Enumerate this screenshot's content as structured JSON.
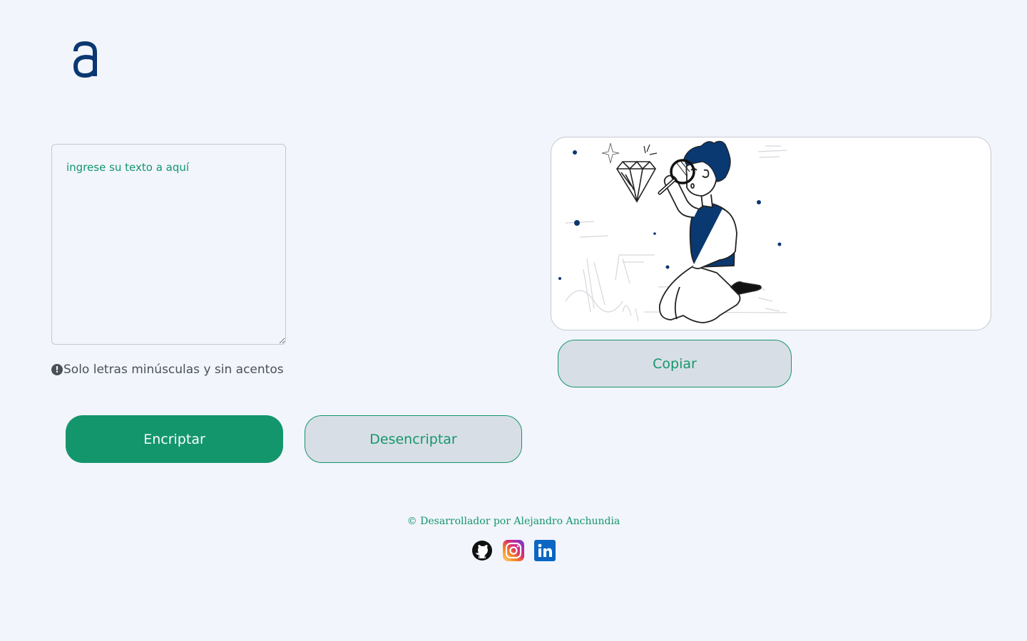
{
  "app": {
    "logo_letter": "a",
    "brand_color": "#0a3871",
    "accent_color": "#14966c",
    "background_color": "#f2f5fc"
  },
  "input": {
    "placeholder": "ingrese su texto a aquí",
    "value": ""
  },
  "hint": {
    "icon": "exclamation-circle-icon",
    "text": "Solo letras minúsculas y sin acentos"
  },
  "buttons": {
    "encrypt_label": "Encriptar",
    "decrypt_label": "Desencriptar",
    "copy_label": "Copiar"
  },
  "output": {
    "illustration": "person-with-magnifying-glass-and-diamond"
  },
  "footer": {
    "credit": "© Desarrollador por Alejandro Anchundia",
    "social": [
      {
        "name": "github-icon"
      },
      {
        "name": "instagram-icon"
      },
      {
        "name": "linkedin-icon"
      }
    ]
  }
}
